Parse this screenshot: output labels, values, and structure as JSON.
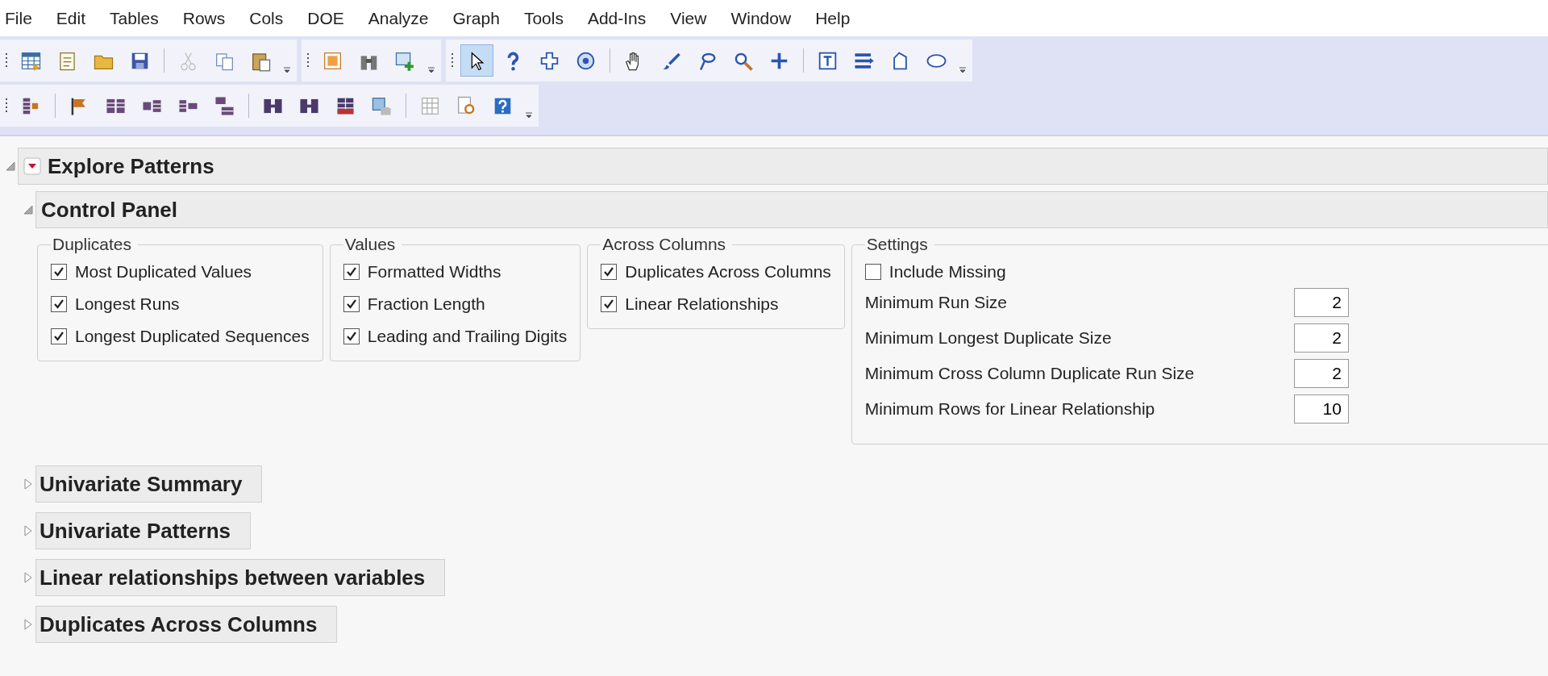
{
  "menu": [
    "File",
    "Edit",
    "Tables",
    "Rows",
    "Cols",
    "DOE",
    "Analyze",
    "Graph",
    "Tools",
    "Add-Ins",
    "View",
    "Window",
    "Help"
  ],
  "toolbar_rows": [
    [
      {
        "groups": [
          [
            {
              "selected": false
            },
            {
              "selected": false
            },
            {
              "selected": false
            },
            {
              "selected": false
            }
          ],
          [
            {
              "selected": false
            },
            {
              "selected": false
            },
            {
              "selected": false
            }
          ]
        ]
      },
      {
        "groups": [
          [
            {
              "selected": false
            },
            {
              "selected": false
            },
            {
              "selected": false
            }
          ]
        ]
      },
      {
        "groups": [
          [
            {
              "selected": true
            },
            {
              "selected": false
            },
            {
              "selected": false
            },
            {
              "selected": false
            }
          ],
          [
            {
              "selected": false
            },
            {
              "selected": false
            },
            {
              "selected": false
            },
            {
              "selected": false
            },
            {
              "selected": false
            }
          ],
          [
            {
              "selected": false
            },
            {
              "selected": false
            },
            {
              "selected": false
            },
            {
              "selected": false
            }
          ]
        ]
      }
    ],
    [
      {
        "groups": [
          [
            {
              "selected": false
            }
          ],
          [
            {
              "selected": false
            },
            {
              "selected": false
            },
            {
              "selected": false
            },
            {
              "selected": false
            },
            {
              "selected": false
            }
          ],
          [
            {
              "selected": false
            },
            {
              "selected": false
            },
            {
              "selected": false
            },
            {
              "selected": false
            }
          ],
          [
            {
              "selected": false
            },
            {
              "selected": false
            },
            {
              "selected": false
            }
          ]
        ]
      }
    ]
  ],
  "report": {
    "title": "Explore Patterns",
    "expanded": true,
    "control_panel": {
      "title": "Control Panel",
      "expanded": true,
      "groups": [
        {
          "title": "Duplicates",
          "options": [
            {
              "label": "Most Duplicated Values",
              "checked": true
            },
            {
              "label": "Longest Runs",
              "checked": true
            },
            {
              "label": "Longest Duplicated Sequences",
              "checked": true
            }
          ]
        },
        {
          "title": "Values",
          "options": [
            {
              "label": "Formatted Widths",
              "checked": true
            },
            {
              "label": "Fraction Length",
              "checked": true
            },
            {
              "label": "Leading and Trailing Digits",
              "checked": true
            }
          ]
        },
        {
          "title": "Across Columns",
          "options": [
            {
              "label": "Duplicates Across Columns",
              "checked": true
            },
            {
              "label": "Linear Relationships",
              "checked": true
            }
          ]
        }
      ],
      "settings": {
        "title": "Settings",
        "options": [
          {
            "label": "Include Missing",
            "checked": false
          }
        ],
        "fields": [
          {
            "label": "Minimum Run Size",
            "value": "2"
          },
          {
            "label": "Minimum Longest Duplicate Size",
            "value": "2"
          },
          {
            "label": "Minimum Cross Column Duplicate Run Size",
            "value": "2"
          },
          {
            "label": "Minimum Rows for Linear Relationship",
            "value": "10"
          }
        ]
      }
    },
    "sections": [
      {
        "title": "Univariate Summary",
        "expanded": false
      },
      {
        "title": "Univariate Patterns",
        "expanded": false
      },
      {
        "title": "Linear relationships between variables",
        "expanded": false
      },
      {
        "title": "Duplicates Across Columns",
        "expanded": false
      }
    ]
  }
}
